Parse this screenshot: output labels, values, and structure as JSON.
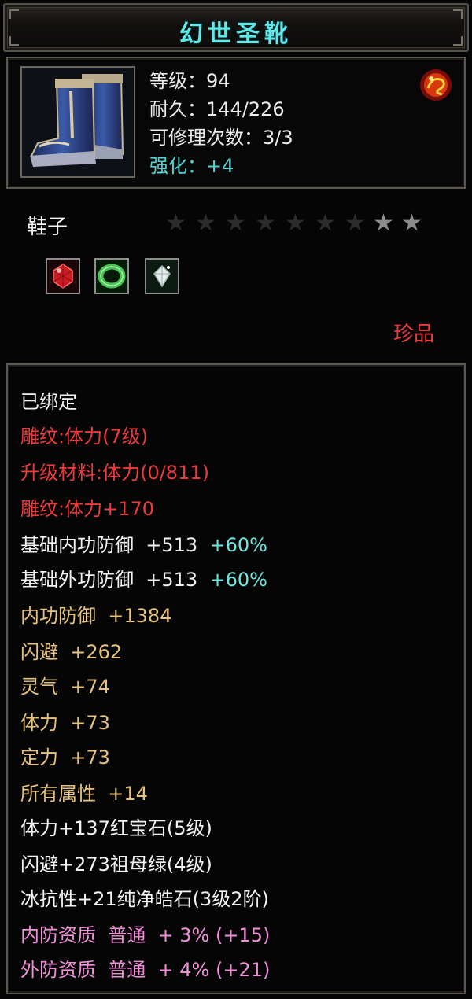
{
  "item": {
    "title": "幻世圣靴",
    "level": "等级：94",
    "durability": "耐久：144/226",
    "repair": "可修理次数：3/3",
    "enhance": "强化：+4",
    "type": "鞋子",
    "rarity": "珍品",
    "stars_total": 9,
    "stars_lit": 2
  },
  "sockets": [
    {
      "name": "red-gem",
      "color": "#d42a2a"
    },
    {
      "name": "green-gem",
      "color": "#3fb24a"
    },
    {
      "name": "white-gem",
      "color": "#dcdcdc"
    }
  ],
  "attributes": {
    "bound": "已绑定",
    "carve1": "雕纹:体力(7级)",
    "upgrade": "升级材料:体力(0/811)",
    "carve2": "雕纹:体力+170",
    "base_inner_label": "基础内功防御  +513",
    "base_inner_pct": "+60%",
    "base_outer_label": "基础外功防御  +513",
    "base_outer_pct": "+60%",
    "inner_def": "内功防御  +1384",
    "dodge": "闪避  +262",
    "spirit": "灵气  +74",
    "stamina": "体力  +73",
    "focus": "定力  +73",
    "all_attr": "所有属性  +14",
    "gem1": "体力+137红宝石(5级)",
    "gem2": "闪避+273祖母绿(4级)",
    "gem3": "冰抗性+21纯净皓石(3级2阶)",
    "q_inner_label": "内防资质",
    "q_inner_value": "普通  + 3% (+15)",
    "q_outer_label": "外防资质",
    "q_outer_value": "普通  + 4% (+21)"
  },
  "colors": {
    "title": "#62e8e8",
    "red": "#ec3b3b",
    "gold": "#e6c27a",
    "teal": "#6ee7e0",
    "pink": "#f08fd8"
  }
}
